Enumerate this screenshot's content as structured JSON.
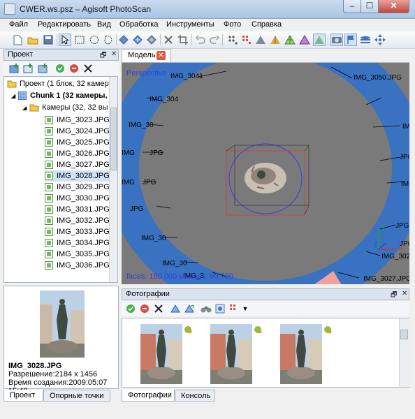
{
  "window": {
    "title": "CWER.ws.psz – Agisoft PhotoScan",
    "min": "–",
    "max": "☐",
    "close": "✕"
  },
  "menu": [
    "Файл",
    "Редактировать",
    "Вид",
    "Обработка",
    "Инструменты",
    "Фото",
    "Справка"
  ],
  "project_panel": {
    "title": "Проект",
    "root": "Проект (1 блок, 32 камер",
    "chunk": "Chunk 1 (32 камеры,",
    "cameras_folder": "Камеры (32, 32 вы",
    "images": [
      "IMG_3023.JPG",
      "IMG_3024.JPG",
      "IMG_3025.JPG",
      "IMG_3026.JPG",
      "IMG_3027.JPG",
      "IMG_3028.JPG",
      "IMG_3029.JPG",
      "IMG_3030.JPG",
      "IMG_3031.JPG",
      "IMG_3032.JPG",
      "IMG_3033.JPG",
      "IMG_3034.JPG",
      "IMG_3035.JPG",
      "IMG_3036.JPG"
    ],
    "selected_image": "IMG_3028.JPG"
  },
  "preview": {
    "name": "IMG_3028.JPG",
    "resolution": "Разрешение:2184 x 1456",
    "created": "Время создания:2009:05:07 15:48"
  },
  "left_tabs": [
    "Проект",
    "Опорные точки"
  ],
  "model_tab": {
    "label": "Модель"
  },
  "viewport": {
    "projection": "Perspective",
    "stats": "faces: 180 000 vertices: 90 730",
    "camera_labels": [
      "IMG_3041",
      "IMG_3050.JPG",
      "IMG_304",
      "IMG_30",
      "IMG_3",
      "JPG",
      "JPG",
      "IMG_3",
      "JPG",
      "IMG_30",
      "IMG_30",
      "IMG_3027.JPG",
      "JPG",
      "IMG_3026",
      "JPG",
      "JPG",
      "IMG_3"
    ],
    "axis_labels": {
      "x": "X",
      "y": "Y",
      "z": "Z"
    }
  },
  "photos_panel": {
    "title": "Фотографии",
    "thumbnails": [
      "IMG_3023.JPG",
      "IMG_3024.JPG",
      "IMG_3025.JPG"
    ]
  },
  "bottom_tabs": [
    "Фотографии",
    "Консоль"
  ],
  "colors": {
    "accent": "#3a72c2",
    "viewport_bg": "#7a7a7a",
    "camera_ring": "#3a72c2"
  }
}
